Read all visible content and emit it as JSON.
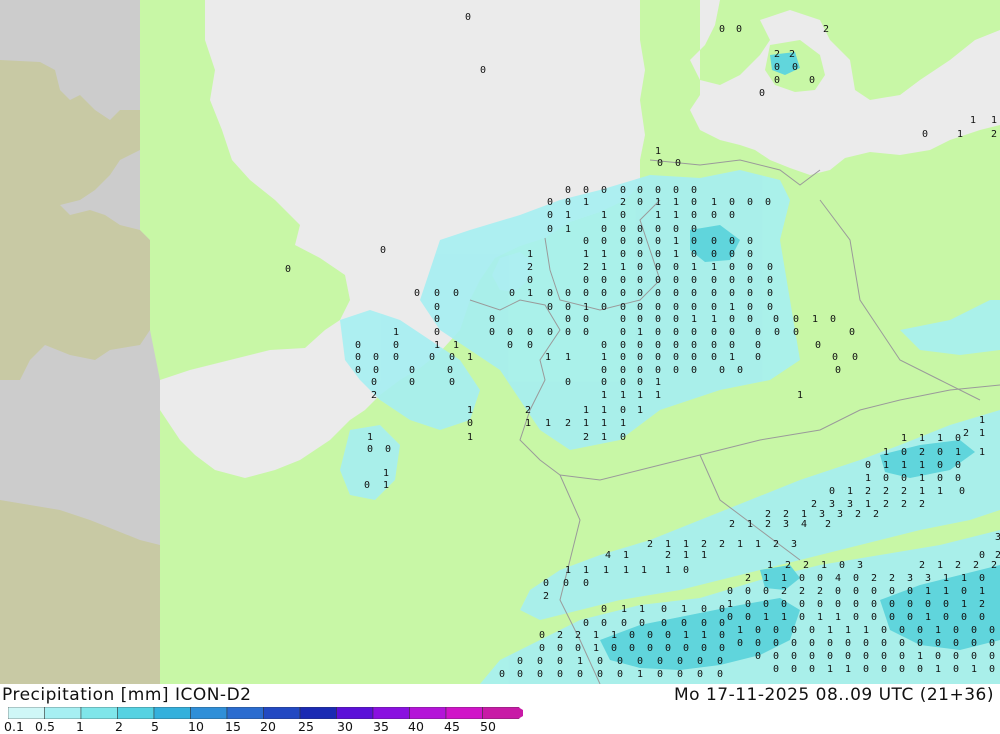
{
  "footer": {
    "title": "Precipitation [mm] ICON-D2",
    "run": "Mo 17-11-2025 08..09 UTC (21+36)"
  },
  "legend": {
    "ticks": [
      "0.1",
      "0.5",
      "1",
      "2",
      "5",
      "10",
      "15",
      "20",
      "25",
      "30",
      "35",
      "40",
      "45",
      "50"
    ],
    "colors": [
      "#cff7f7",
      "#a6eff2",
      "#7fe6ea",
      "#55d2e2",
      "#34b0dc",
      "#2f8fd8",
      "#2a6ccf",
      "#2249c2",
      "#1a2ab3",
      "#5b10d8",
      "#8a10e0",
      "#b414d8",
      "#d014c8",
      "#c81aa6"
    ]
  },
  "map": {
    "colors": {
      "land_in_domain": "#c8f7a6",
      "sea": "#ebebeb",
      "outside_land": "#c8c9a4",
      "outside_sea": "#cccccc",
      "precip_light": "#a6eff2",
      "precip_mid": "#55d2e2"
    },
    "value_labels": [
      "0",
      "0",
      "0",
      "0",
      "0",
      "0",
      "2",
      "2",
      "2",
      "0",
      "0",
      "0",
      "0",
      "0",
      "1",
      "1",
      "0",
      "1",
      "2",
      "1",
      "0",
      "0",
      "0",
      "0",
      "0",
      "0",
      "0",
      "0",
      "0",
      "0",
      "0",
      "0",
      "1",
      "2",
      "0",
      "1",
      "1",
      "0",
      "1",
      "0",
      "0",
      "0",
      "0",
      "1",
      "1",
      "0",
      "1",
      "1",
      "0",
      "0",
      "0",
      "0",
      "1",
      "0",
      "0",
      "0",
      "0",
      "0",
      "0",
      "0",
      "0",
      "0",
      "0",
      "0",
      "1",
      "0",
      "0",
      "0",
      "0",
      "1",
      "1",
      "1",
      "0",
      "0",
      "0",
      "1",
      "0",
      "0",
      "0",
      "0",
      "2",
      "2",
      "1",
      "1",
      "0",
      "0",
      "0",
      "1",
      "1",
      "0",
      "0",
      "0",
      "0",
      "0",
      "0",
      "0",
      "0",
      "0",
      "0",
      "0",
      "0",
      "0",
      "0",
      "0",
      "0",
      "0",
      "0",
      "0",
      "1",
      "0",
      "0",
      "0",
      "0",
      "0",
      "0",
      "0",
      "0",
      "0",
      "0",
      "0",
      "0",
      "0",
      "0",
      "0",
      "0",
      "1",
      "0",
      "0",
      "0",
      "0",
      "0",
      "0",
      "0",
      "1",
      "0",
      "0",
      "0",
      "0",
      "0",
      "0",
      "0",
      "0",
      "0",
      "0",
      "1",
      "1",
      "0",
      "0",
      "0",
      "0",
      "1",
      "0",
      "1",
      "0",
      "0",
      "0",
      "0",
      "0",
      "0",
      "0",
      "0",
      "1",
      "0",
      "0",
      "0",
      "0",
      "0",
      "0",
      "0",
      "0",
      "0",
      "0",
      "0",
      "1",
      "1",
      "0",
      "0",
      "0",
      "0",
      "0",
      "0",
      "0",
      "0",
      "0",
      "0",
      "0",
      "0",
      "0",
      "0",
      "0",
      "0",
      "0",
      "1",
      "1",
      "1",
      "1",
      "0",
      "0",
      "0",
      "0",
      "0",
      "0",
      "1",
      "0",
      "0",
      "0",
      "0",
      "0",
      "0",
      "0",
      "0",
      "0",
      "0",
      "0",
      "0",
      "0",
      "0",
      "0",
      "0",
      "0",
      "0",
      "0",
      "0",
      "0",
      "0",
      "0",
      "1",
      "2",
      "1",
      "1",
      "1",
      "1",
      "1",
      "1",
      "2",
      "1",
      "1",
      "0",
      "1",
      "0",
      "1",
      "1",
      "2",
      "1",
      "1",
      "1",
      "1",
      "1",
      "2",
      "1",
      "0",
      "0",
      "0",
      "1",
      "0",
      "1",
      "1",
      "2",
      "1",
      "1",
      "1",
      "1",
      "0",
      "1",
      "0",
      "2",
      "0",
      "1",
      "1",
      "0",
      "1",
      "1",
      "1",
      "0",
      "0",
      "1",
      "0",
      "0",
      "1",
      "0",
      "0",
      "0",
      "1",
      "2",
      "2",
      "2",
      "1",
      "1",
      "0",
      "2",
      "3",
      "3",
      "1",
      "2",
      "2",
      "2",
      "2",
      "2",
      "1",
      "3",
      "3",
      "2",
      "2",
      "2",
      "1",
      "2",
      "3",
      "4",
      "2",
      "3",
      "2",
      "1",
      "1",
      "2",
      "2",
      "1",
      "1",
      "2",
      "3",
      "4",
      "1",
      "2",
      "1",
      "1",
      "0",
      "2",
      "1",
      "2",
      "2",
      "1",
      "0",
      "3",
      "2",
      "1",
      "2",
      "2",
      "2",
      "1",
      "1",
      "1",
      "1",
      "1",
      "1",
      "0",
      "2",
      "1",
      "1",
      "0",
      "0",
      "4",
      "0",
      "2",
      "2",
      "3",
      "3",
      "1",
      "1",
      "0"
    ]
  }
}
